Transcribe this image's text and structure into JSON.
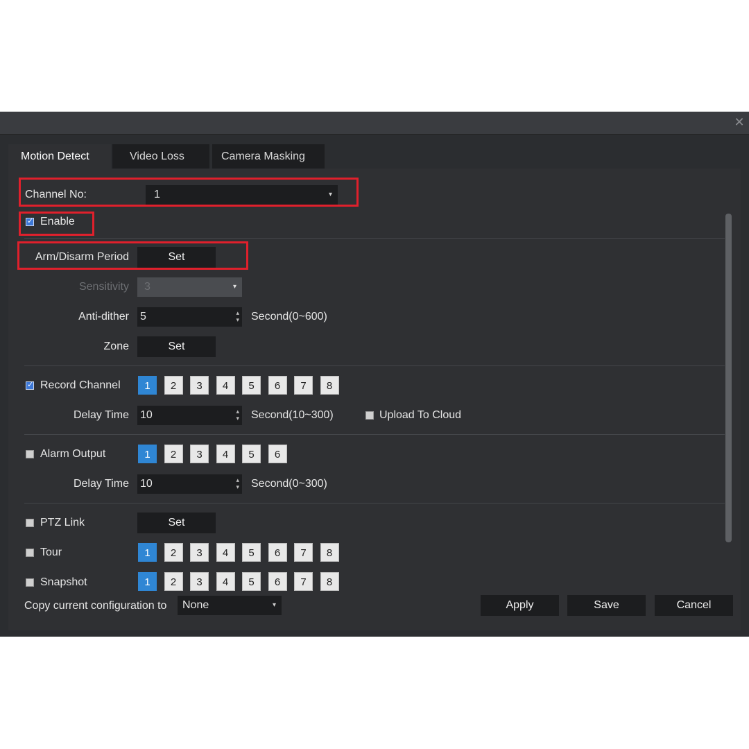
{
  "tabs": [
    {
      "label": "Motion Detect",
      "active": true
    },
    {
      "label": "Video Loss",
      "active": false
    },
    {
      "label": "Camera Masking",
      "active": false
    }
  ],
  "channel": {
    "label": "Channel No:",
    "value": "1"
  },
  "enable": {
    "label": "Enable",
    "checked": true
  },
  "arm_disarm": {
    "label": "Arm/Disarm Period",
    "button": "Set"
  },
  "sensitivity": {
    "label": "Sensitivity",
    "value": "3"
  },
  "anti_dither": {
    "label": "Anti-dither",
    "value": "5",
    "unit": "Second(0~600)"
  },
  "zone": {
    "label": "Zone",
    "button": "Set"
  },
  "record_channel": {
    "label": "Record Channel",
    "checked": true,
    "channels": [
      "1",
      "2",
      "3",
      "4",
      "5",
      "6",
      "7",
      "8"
    ],
    "selected": "1",
    "delay_label": "Delay Time",
    "delay_value": "10",
    "delay_unit": "Second(10~300)",
    "upload_label": "Upload To Cloud",
    "upload_checked": false
  },
  "alarm_output": {
    "label": "Alarm Output",
    "checked": false,
    "channels": [
      "1",
      "2",
      "3",
      "4",
      "5",
      "6"
    ],
    "selected": "1",
    "delay_label": "Delay Time",
    "delay_value": "10",
    "delay_unit": "Second(0~300)"
  },
  "ptz_link": {
    "label": "PTZ Link",
    "checked": false,
    "button": "Set"
  },
  "tour": {
    "label": "Tour",
    "checked": false,
    "channels": [
      "1",
      "2",
      "3",
      "4",
      "5",
      "6",
      "7",
      "8"
    ],
    "selected": "1"
  },
  "snapshot": {
    "label": "Snapshot",
    "checked": false,
    "channels": [
      "1",
      "2",
      "3",
      "4",
      "5",
      "6",
      "7",
      "8"
    ],
    "selected": "1"
  },
  "copy": {
    "label": "Copy current configuration to",
    "value": "None"
  },
  "footer": {
    "apply": "Apply",
    "save": "Save",
    "cancel": "Cancel"
  },
  "icons": {
    "close": "close-icon",
    "dropdown": "chevron-down-icon",
    "spinner": "spinner-arrows-icon",
    "checkbox": "checkbox-icon"
  },
  "colors": {
    "background": "#2b2d30",
    "selected": "#2f86d4",
    "highlight": "#e0202c"
  }
}
